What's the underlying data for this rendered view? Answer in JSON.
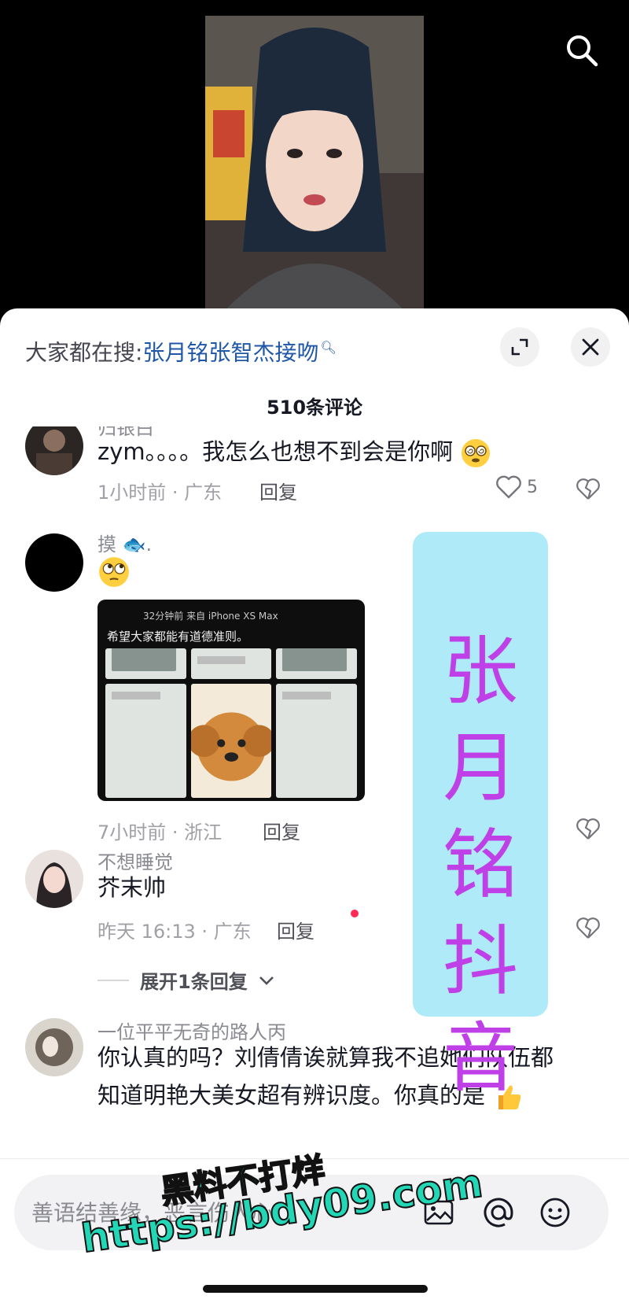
{
  "video": {
    "search_icon": "search-icon"
  },
  "panel": {
    "hot_search_prefix": "大家都在搜:",
    "hot_search_term": "张月铭张智杰接吻",
    "expand_icon": "expand-icon",
    "close_icon": "close-icon",
    "comment_count": "510条评论"
  },
  "comments": [
    {
      "username": "归银白",
      "text": "zym。。。。我怎么也想不到会是你啊",
      "emoji": "dizzy-eyes-emoji",
      "time": "1小时前 · 广东",
      "reply_label": "回复",
      "likes": "5"
    },
    {
      "username": "摸 🐟.",
      "text_emoji": "rolling-eyes-emoji",
      "image": {
        "caption": "32分钟前  来自 iPhone XS Max",
        "title": "希望大家都能有道德准则。"
      },
      "time": "7小时前 · 浙江",
      "reply_label": "回复"
    },
    {
      "username": "不想睡觉",
      "text": "芥末帅",
      "time": "昨天 16:13 · 广东",
      "reply_label": "回复",
      "expand_label": "展开1条回复"
    },
    {
      "username": "一位平平无奇的路人丙",
      "text_line1": "你认真的吗？刘倩倩诶就算我不追她们队伍都",
      "text_line2": "知道明艳大美女超有辨识度。你真的是"
    }
  ],
  "promo": {
    "chars": [
      "张",
      "月",
      "铭",
      "抖",
      "音"
    ]
  },
  "watermark": {
    "line1": "黑料不打烊",
    "line2": "https://bdy09.com"
  },
  "input": {
    "placeholder": "善语结善缘，恶言伤人心",
    "icons": [
      "image-icon",
      "at-icon",
      "emoji-icon"
    ]
  },
  "colors": {
    "accent": "#fe2c55",
    "link": "#1f57a8",
    "promo_bg": "#aeeaf8",
    "promo_text": "#c040e8"
  }
}
